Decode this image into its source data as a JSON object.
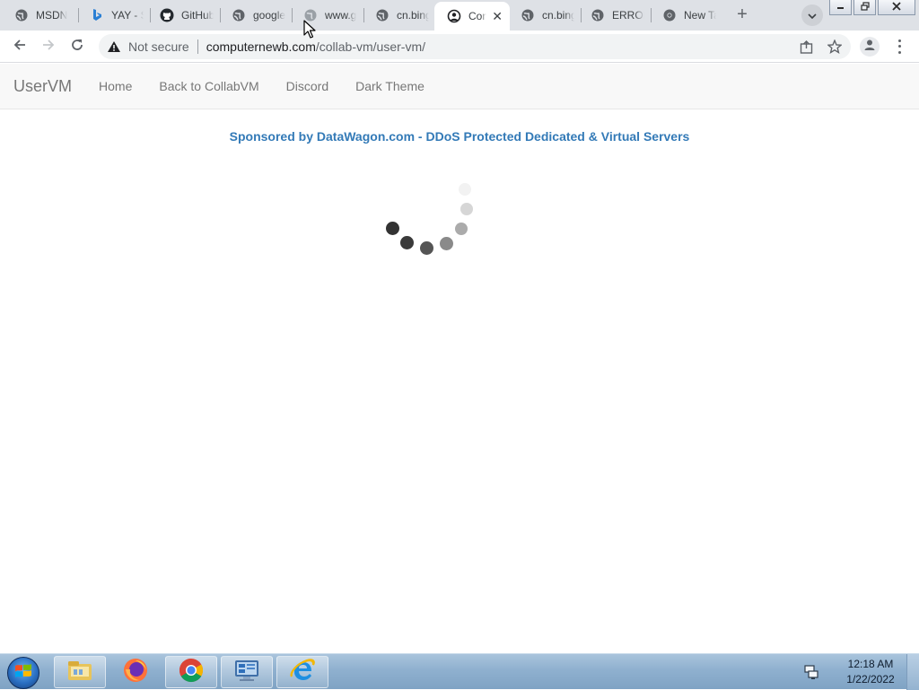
{
  "browser": {
    "tabs": [
      {
        "label": "MSDN",
        "icon": "globe-icon",
        "active": false
      },
      {
        "label": "YAY - S",
        "icon": "bing-icon",
        "active": false
      },
      {
        "label": "GitHub",
        "icon": "github-icon",
        "active": false
      },
      {
        "label": "google",
        "icon": "globe-icon",
        "active": false
      },
      {
        "label": "www.g",
        "icon": "loading-icon",
        "active": false
      },
      {
        "label": "cn.bing",
        "icon": "globe-icon",
        "active": false
      },
      {
        "label": "Com",
        "icon": "collabvm-icon",
        "active": true,
        "close": "✕"
      },
      {
        "label": "cn.bing",
        "icon": "globe-icon",
        "active": false
      },
      {
        "label": "ERROR",
        "icon": "globe-icon",
        "active": false
      },
      {
        "label": "New Ta",
        "icon": "chrome-icon",
        "active": false
      }
    ],
    "new_tab": "+",
    "address": {
      "security_label": "Not secure",
      "host": "computernewb.com",
      "path": "/collab-vm/user-vm/"
    }
  },
  "site": {
    "brand": "UserVM",
    "nav": [
      "Home",
      "Back to CollabVM",
      "Discord",
      "Dark Theme"
    ],
    "sponsor": "Sponsored by DataWagon.com - DDoS Protected Dedicated & Virtual Servers",
    "colors": {
      "link": "#337ab7",
      "navbar_bg": "#f8f8f8",
      "nav_text": "#777777"
    }
  },
  "taskbar": {
    "apps": [
      "file-explorer-icon",
      "firefox-icon",
      "chrome-icon",
      "control-panel-icon",
      "internet-explorer-icon"
    ],
    "clock": {
      "time": "12:18 AM",
      "date": "1/22/2022"
    }
  }
}
